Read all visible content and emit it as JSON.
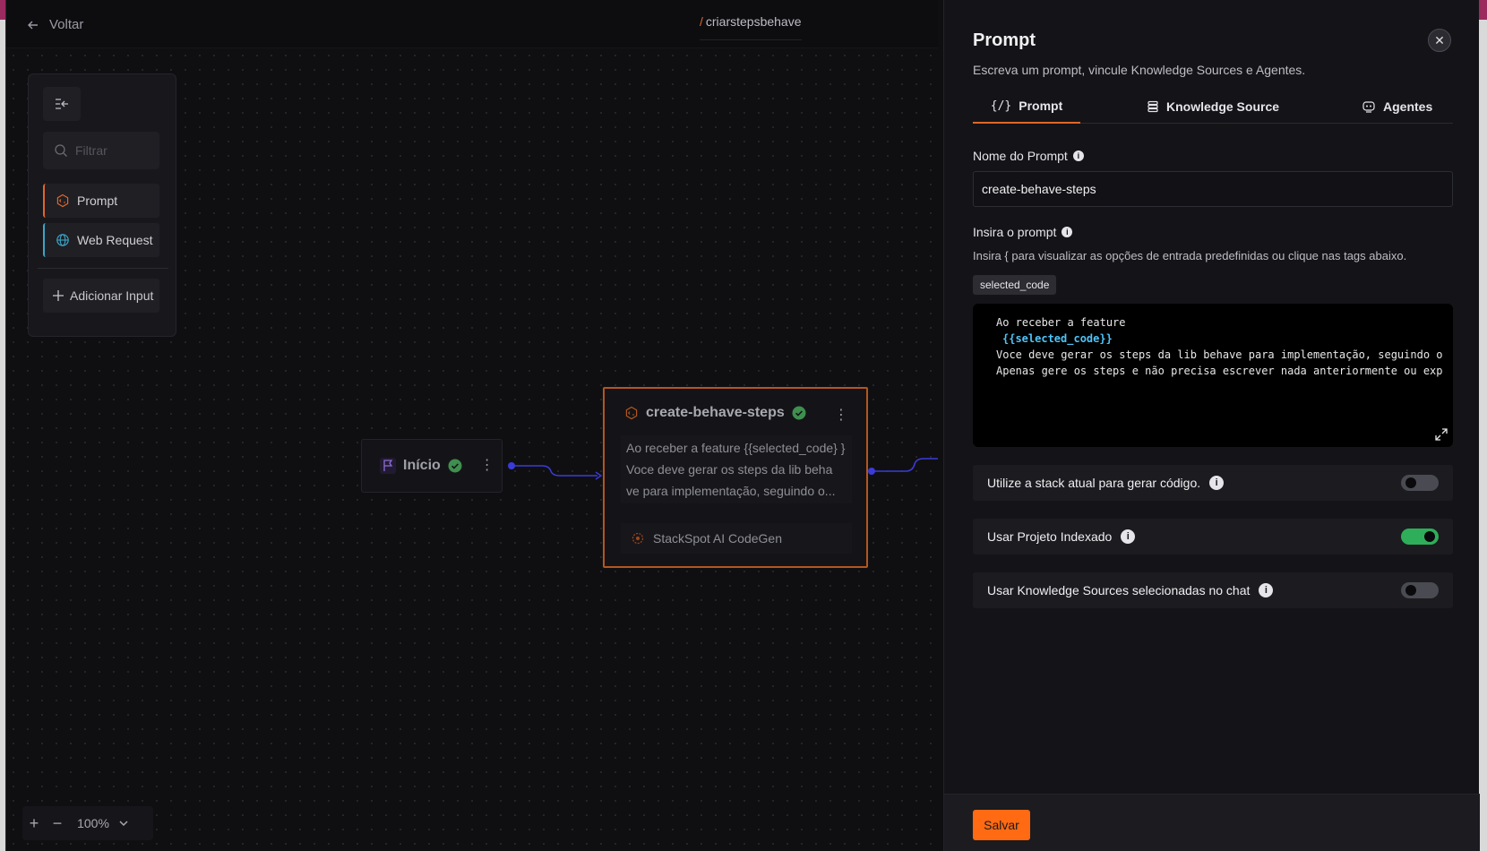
{
  "header": {
    "back_label": "Voltar",
    "breadcrumb_slash": "/",
    "breadcrumb_name": "criarstepsbehave"
  },
  "palette": {
    "filter_placeholder": "Filtrar",
    "items": [
      {
        "label": "Prompt",
        "icon": "prompt-node-icon",
        "accent": "#e0662a"
      },
      {
        "label": "Web Request",
        "icon": "globe-icon",
        "accent": "#3aa6c9"
      }
    ],
    "add_input_label": "Adicionar Input"
  },
  "canvas": {
    "start_node": {
      "label": "Início",
      "status": "valid"
    },
    "prompt_node": {
      "title": "create-behave-steps",
      "status": "valid",
      "body": "Ao receber a feature {{selected_code} } Voce deve gerar os steps da lib beha ve para implementação, seguindo o...",
      "footer": "StackSpot AI CodeGen"
    },
    "zoom": {
      "value": "100%"
    }
  },
  "panel": {
    "title": "Prompt",
    "subtitle": "Escreva um prompt, vincule Knowledge Sources e Agentes.",
    "tabs": [
      {
        "label": "Prompt",
        "icon": "code-braces-icon",
        "active": true
      },
      {
        "label": "Knowledge Source",
        "icon": "database-icon",
        "active": false
      },
      {
        "label": "Agentes",
        "icon": "agent-icon",
        "active": false
      }
    ],
    "prompt_name_label": "Nome do Prompt",
    "prompt_name_value": "create-behave-steps",
    "prompt_label": "Insira o prompt",
    "prompt_hint": "Insira { para visualizar as opções de entrada predefinidas ou clique nas tags abaixo.",
    "tag": "selected_code",
    "editor_lines": [
      "Ao receber a feature",
      "",
      "{{selected_code}}",
      "",
      "Voce deve gerar os steps da lib behave para implementação, seguindo o",
      "Apenas gere os steps e não precisa escrever nada anteriormente ou exp"
    ],
    "toggles": [
      {
        "label": "Utilize a stack atual para gerar código.",
        "on": false
      },
      {
        "label": "Usar Projeto Indexado",
        "on": true
      },
      {
        "label": "Usar Knowledge Sources selecionadas no chat",
        "on": false
      }
    ],
    "save_label": "Salvar"
  }
}
